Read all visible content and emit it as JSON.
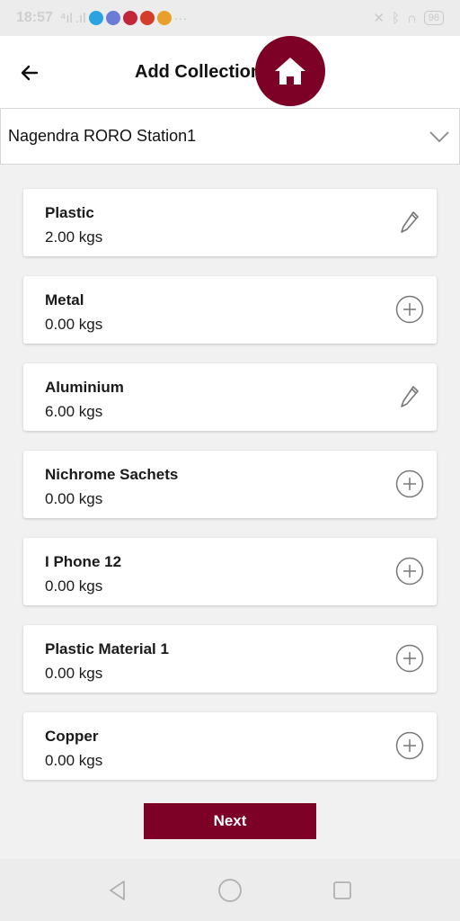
{
  "status_bar": {
    "time": "18:57",
    "battery": "96"
  },
  "header": {
    "title": "Add Collection"
  },
  "station": {
    "selected": "Nagendra RORO Station1"
  },
  "materials": [
    {
      "name": "Plastic",
      "qty": "2.00 kgs",
      "action": "edit"
    },
    {
      "name": "Metal",
      "qty": "0.00 kgs",
      "action": "add"
    },
    {
      "name": "Aluminium",
      "qty": "6.00 kgs",
      "action": "edit"
    },
    {
      "name": "Nichrome Sachets",
      "qty": "0.00 kgs",
      "action": "add"
    },
    {
      "name": "I Phone 12",
      "qty": "0.00 kgs",
      "action": "add"
    },
    {
      "name": "Plastic Material 1",
      "qty": "0.00 kgs",
      "action": "add"
    },
    {
      "name": "Copper",
      "qty": "0.00 kgs",
      "action": "add"
    }
  ],
  "footer": {
    "next_label": "Next"
  },
  "colors": {
    "brand": "#7d0027",
    "icon_gray": "#777777"
  }
}
